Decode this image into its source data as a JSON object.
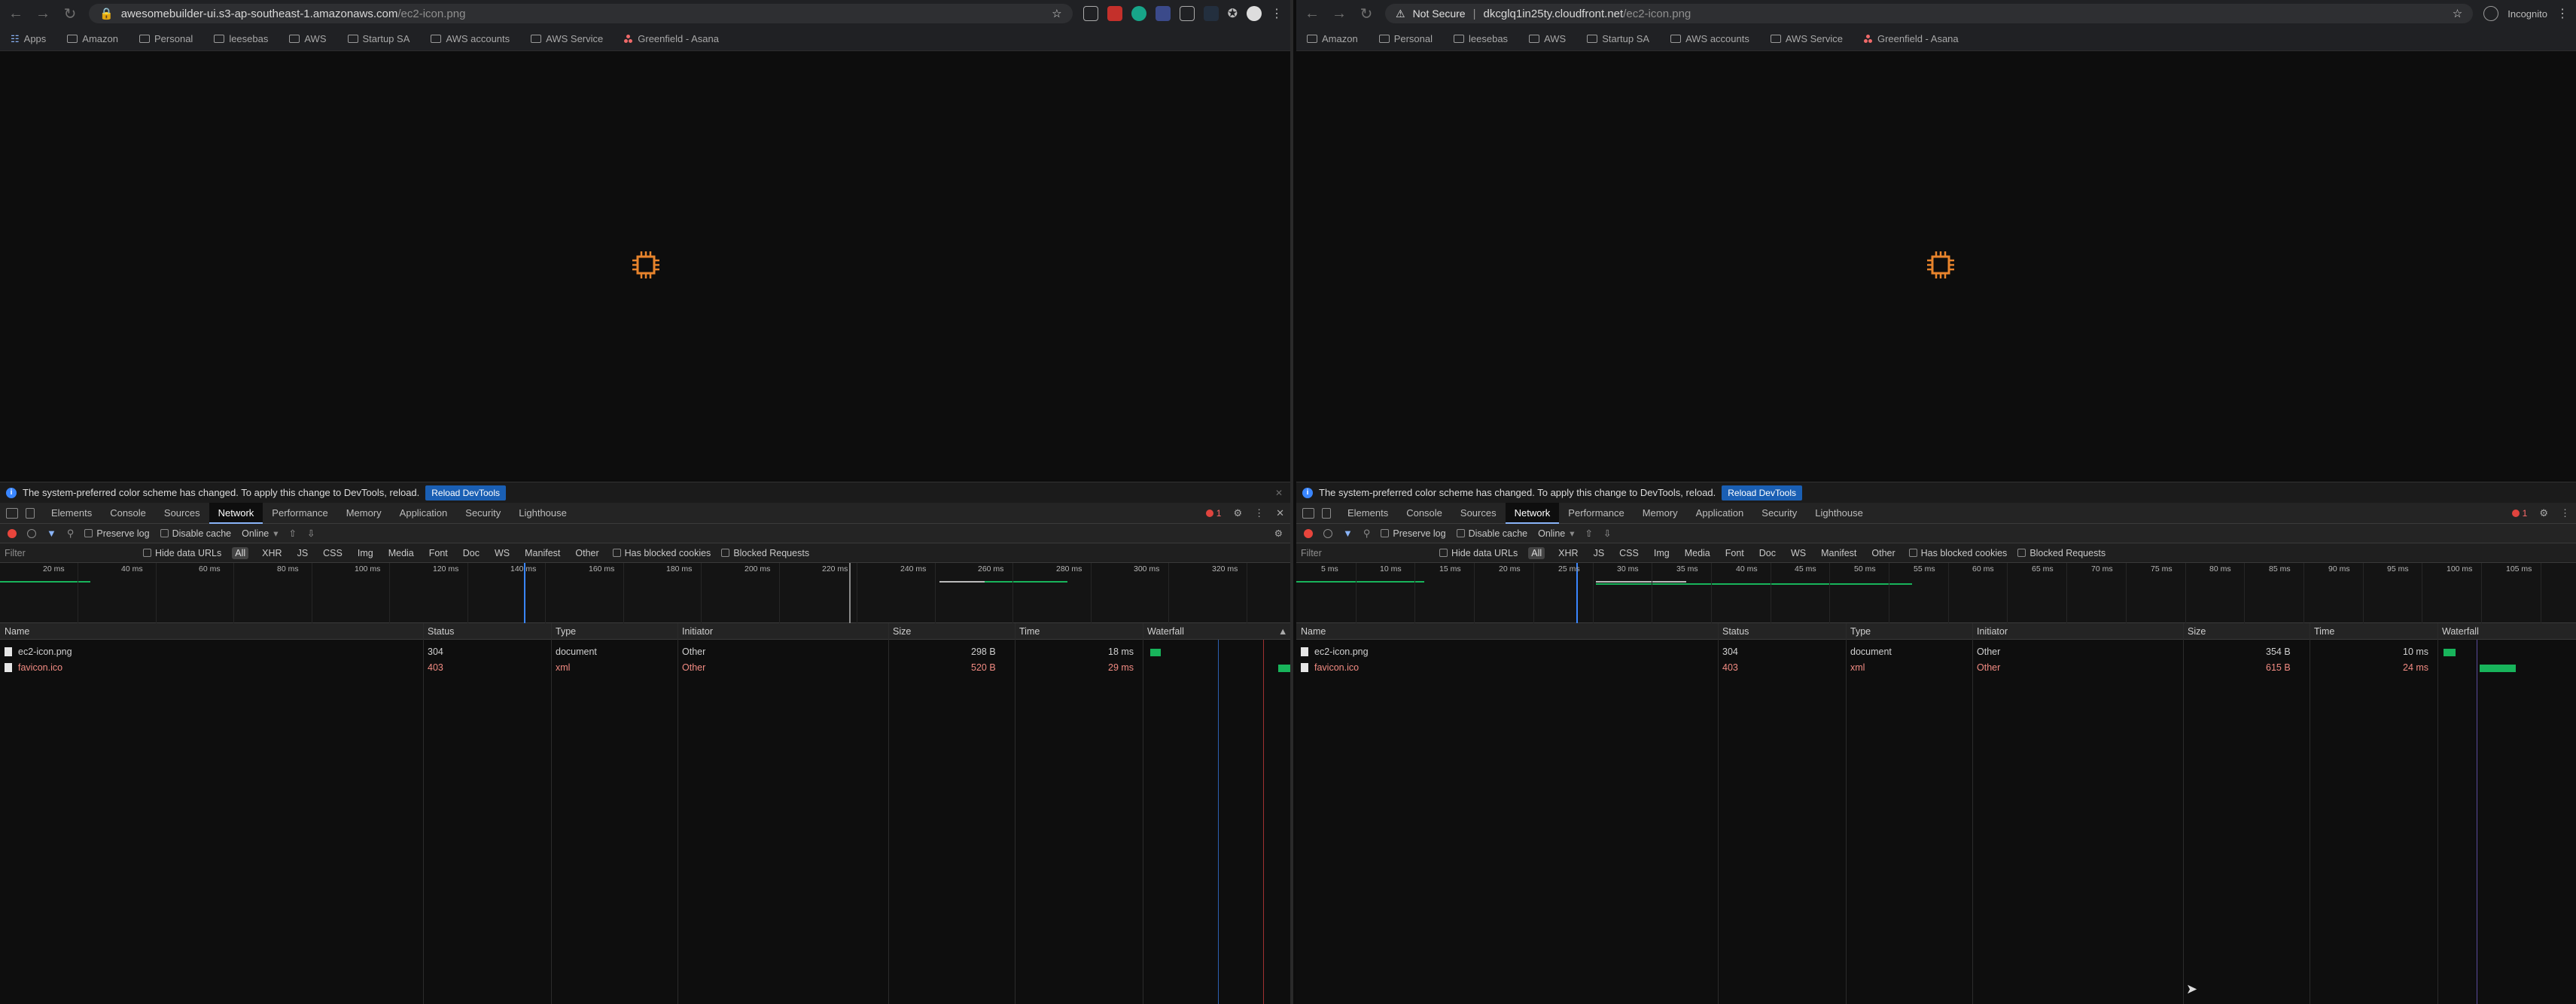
{
  "left": {
    "url": {
      "host": "awesomebuilder-ui.s3-ap-southeast-1.amazonaws.com",
      "path": "/ec2-icon.png"
    },
    "bookmarks": [
      "Apps",
      "Amazon",
      "Personal",
      "leesebas",
      "AWS",
      "Startup SA",
      "AWS accounts",
      "AWS Service",
      "Greenfield - Asana"
    ],
    "infobar": {
      "message": "The system-preferred color scheme has changed. To apply this change to DevTools, reload.",
      "button": "Reload DevTools"
    },
    "tabs": [
      "Elements",
      "Console",
      "Sources",
      "Network",
      "Performance",
      "Memory",
      "Application",
      "Security",
      "Lighthouse"
    ],
    "active_tab": "Network",
    "error_count": "1",
    "toolbar": {
      "preserve_log": "Preserve log",
      "disable_cache": "Disable cache",
      "throttle": "Online"
    },
    "filter": {
      "placeholder": "Filter",
      "hide_data_urls": "Hide data URLs",
      "all": "All",
      "types": [
        "XHR",
        "JS",
        "CSS",
        "Img",
        "Media",
        "Font",
        "Doc",
        "WS",
        "Manifest",
        "Other"
      ],
      "blocked_cookies": "Has blocked cookies",
      "blocked_requests": "Blocked Requests"
    },
    "ticks": [
      "20 ms",
      "40 ms",
      "60 ms",
      "80 ms",
      "100 ms",
      "120 ms",
      "140 ms",
      "160 ms",
      "180 ms",
      "200 ms",
      "220 ms",
      "240 ms",
      "260 ms",
      "280 ms",
      "300 ms",
      "320 ms"
    ],
    "columns": {
      "name": "Name",
      "status": "Status",
      "type": "Type",
      "initiator": "Initiator",
      "size": "Size",
      "time": "Time",
      "waterfall": "Waterfall"
    },
    "rows": [
      {
        "name": "ec2-icon.png",
        "status": "304",
        "type": "document",
        "initiator": "Other",
        "size": "298 B",
        "time": "18 ms"
      },
      {
        "name": "favicon.ico",
        "status": "403",
        "type": "xml",
        "initiator": "Other",
        "size": "520 B",
        "time": "29 ms"
      }
    ]
  },
  "right": {
    "security_label": "Not Secure",
    "url": {
      "host": "dkcglq1in25ty.cloudfront.net",
      "path": "/ec2-icon.png"
    },
    "profile": "Incognito",
    "bookmarks": [
      "Amazon",
      "Personal",
      "leesebas",
      "AWS",
      "Startup SA",
      "AWS accounts",
      "AWS Service",
      "Greenfield - Asana"
    ],
    "infobar": {
      "message": "The system-preferred color scheme has changed. To apply this change to DevTools, reload.",
      "button": "Reload DevTools"
    },
    "tabs": [
      "Elements",
      "Console",
      "Sources",
      "Network",
      "Performance",
      "Memory",
      "Application",
      "Security",
      "Lighthouse"
    ],
    "active_tab": "Network",
    "error_count": "1",
    "toolbar": {
      "preserve_log": "Preserve log",
      "disable_cache": "Disable cache",
      "throttle": "Online"
    },
    "filter": {
      "placeholder": "Filter",
      "hide_data_urls": "Hide data URLs",
      "all": "All",
      "types": [
        "XHR",
        "JS",
        "CSS",
        "Img",
        "Media",
        "Font",
        "Doc",
        "WS",
        "Manifest",
        "Other"
      ],
      "blocked_cookies": "Has blocked cookies",
      "blocked_requests": "Blocked Requests"
    },
    "ticks": [
      "5 ms",
      "10 ms",
      "15 ms",
      "20 ms",
      "25 ms",
      "30 ms",
      "35 ms",
      "40 ms",
      "45 ms",
      "50 ms",
      "55 ms",
      "60 ms",
      "65 ms",
      "70 ms",
      "75 ms",
      "80 ms",
      "85 ms",
      "90 ms",
      "95 ms",
      "100 ms",
      "105 ms"
    ],
    "columns": {
      "name": "Name",
      "status": "Status",
      "type": "Type",
      "initiator": "Initiator",
      "size": "Size",
      "time": "Time",
      "waterfall": "Waterfall"
    },
    "rows": [
      {
        "name": "ec2-icon.png",
        "status": "304",
        "type": "document",
        "initiator": "Other",
        "size": "354 B",
        "time": "10 ms"
      },
      {
        "name": "favicon.ico",
        "status": "403",
        "type": "xml",
        "initiator": "Other",
        "size": "615 B",
        "time": "24 ms"
      }
    ]
  },
  "colors": {
    "chip_orange": "#e8842c",
    "bar_green": "#18b45b",
    "error_red": "#f28b82",
    "active_blue": "#8ab4f8"
  }
}
